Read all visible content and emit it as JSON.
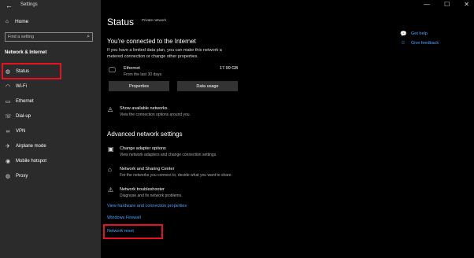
{
  "window": {
    "title": "Settings",
    "controls": [
      "—",
      "☐",
      "✕"
    ]
  },
  "sidebar": {
    "home_label": "Home",
    "search_placeholder": "Find a setting",
    "section_label": "Network & Internet",
    "items": [
      {
        "label": "Status",
        "icon": "globe-icon"
      },
      {
        "label": "Wi-Fi",
        "icon": "wifi-icon"
      },
      {
        "label": "Ethernet",
        "icon": "ethernet-icon"
      },
      {
        "label": "Dial-up",
        "icon": "phone-icon"
      },
      {
        "label": "VPN",
        "icon": "vpn-icon"
      },
      {
        "label": "Airplane mode",
        "icon": "airplane-icon"
      },
      {
        "label": "Mobile hotspot",
        "icon": "hotspot-icon"
      },
      {
        "label": "Proxy",
        "icon": "globe-icon"
      }
    ],
    "highlighted_item": "Status",
    "highlight_color": "#e81123"
  },
  "main": {
    "title": "Status",
    "network_name": "Private network",
    "connected_title": "You're connected to the Internet",
    "connected_desc": "If you have a limited data plan, you can make this network a metered connection or change other properties.",
    "ethernet": {
      "name": "Ethernet",
      "period": "From the last 30 days",
      "usage": "17.99 GB"
    },
    "buttons": {
      "properties": "Properties",
      "data_usage": "Data usage"
    },
    "show_networks": {
      "title": "Show available networks",
      "desc": "View the connection options around you."
    },
    "advanced_title": "Advanced network settings",
    "advanced_items": [
      {
        "title": "Change adapter options",
        "desc": "View network adapters and change connection settings.",
        "icon": "adapter-icon"
      },
      {
        "title": "Network and Sharing Center",
        "desc": "For the networks you connect to, decide what you want to share.",
        "icon": "sharing-icon"
      },
      {
        "title": "Network troubleshooter",
        "desc": "Diagnose and fix network problems.",
        "icon": "warning-icon"
      }
    ],
    "links": {
      "hardware": "View hardware and connection properties",
      "firewall": "Windows Firewall",
      "reset": "Network reset"
    },
    "highlighted_link": "Network reset",
    "link_color": "#4aa3ff"
  },
  "help": {
    "get_help": "Get help",
    "give_feedback": "Give feedback"
  }
}
